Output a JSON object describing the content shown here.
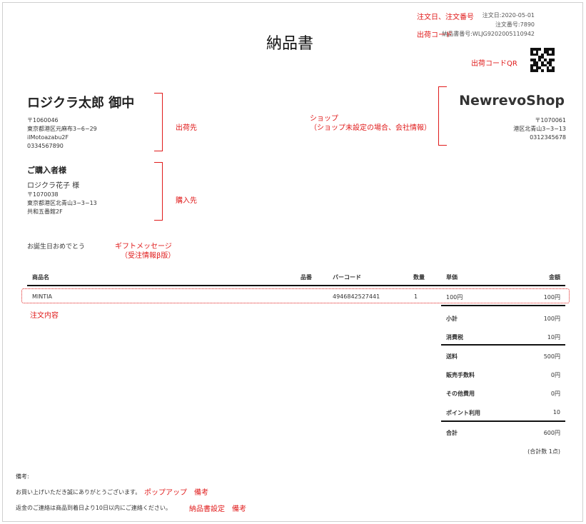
{
  "document": {
    "title": "納品書",
    "order_date_label": "注文日:",
    "order_date": "2020-05-01",
    "order_number_label": "注文番号:",
    "order_number": "7890",
    "slip_number_label": "納品書番号:",
    "slip_number": "WLJG9202005110942"
  },
  "recipient": {
    "name": "ロジクラ太郎 御中",
    "postal": "〒1060046",
    "address1": "東京都港区元麻布3−6−29",
    "address2": "ilMotoazabu2F",
    "phone": "0334567890"
  },
  "shop": {
    "name": "NewrevoShop",
    "postal": "〒1070061",
    "address": "港区北青山3−3−13",
    "phone": "0312345678"
  },
  "purchaser": {
    "heading": "ご購入者様",
    "name": "ロジクラ花子 様",
    "postal": "〒1070038",
    "address1": "東京都港区北青山3−3−13",
    "address2": "共和五番館2F"
  },
  "gift_message": "お誕生日おめでとう",
  "table": {
    "headers": {
      "product": "商品名",
      "sku": "品番",
      "barcode": "バーコード",
      "qty": "数量",
      "unit_price": "単価",
      "amount": "金額"
    },
    "rows": [
      {
        "product": "MINTIA",
        "sku": "",
        "barcode": "4946842527441",
        "qty": "1",
        "unit_price": "100円",
        "amount": "100円"
      }
    ]
  },
  "summary": {
    "subtotal_label": "小計",
    "subtotal": "100円",
    "tax_label": "消費税",
    "tax": "10円",
    "shipping_label": "送料",
    "shipping": "500円",
    "fee_label": "販売手数料",
    "fee": "0円",
    "other_label": "その他費用",
    "other": "0円",
    "points_label": "ポイント利用",
    "points": "10",
    "total_label": "合計",
    "total": "600円",
    "count_note": "(合計数 1点)"
  },
  "notes": {
    "label": "備考:",
    "line1": "お買い上げいただき誠にありがとうございます。",
    "line2": "返金のご連絡は商品到着日より10日以内にご連絡ください。"
  },
  "annotations": {
    "order_info": "注文日、注文番号",
    "shipping_code": "出荷コード",
    "shipping_qr": "出荷コードQR",
    "ship_to": "出荷先",
    "shop": "ショップ",
    "shop_note": "（ショップ未設定の場合、会社情報）",
    "purchaser": "購入先",
    "gift_message": "ギフトメッセージ",
    "gift_note": "（受注情報β版）",
    "order_contents": "注文内容",
    "popup_note": "ポップアップ　備考",
    "slip_setting_note": "納品書設定　備考"
  },
  "colors": {
    "annotation": "#e01b1b",
    "text": "#333333",
    "rule": "#111111"
  }
}
